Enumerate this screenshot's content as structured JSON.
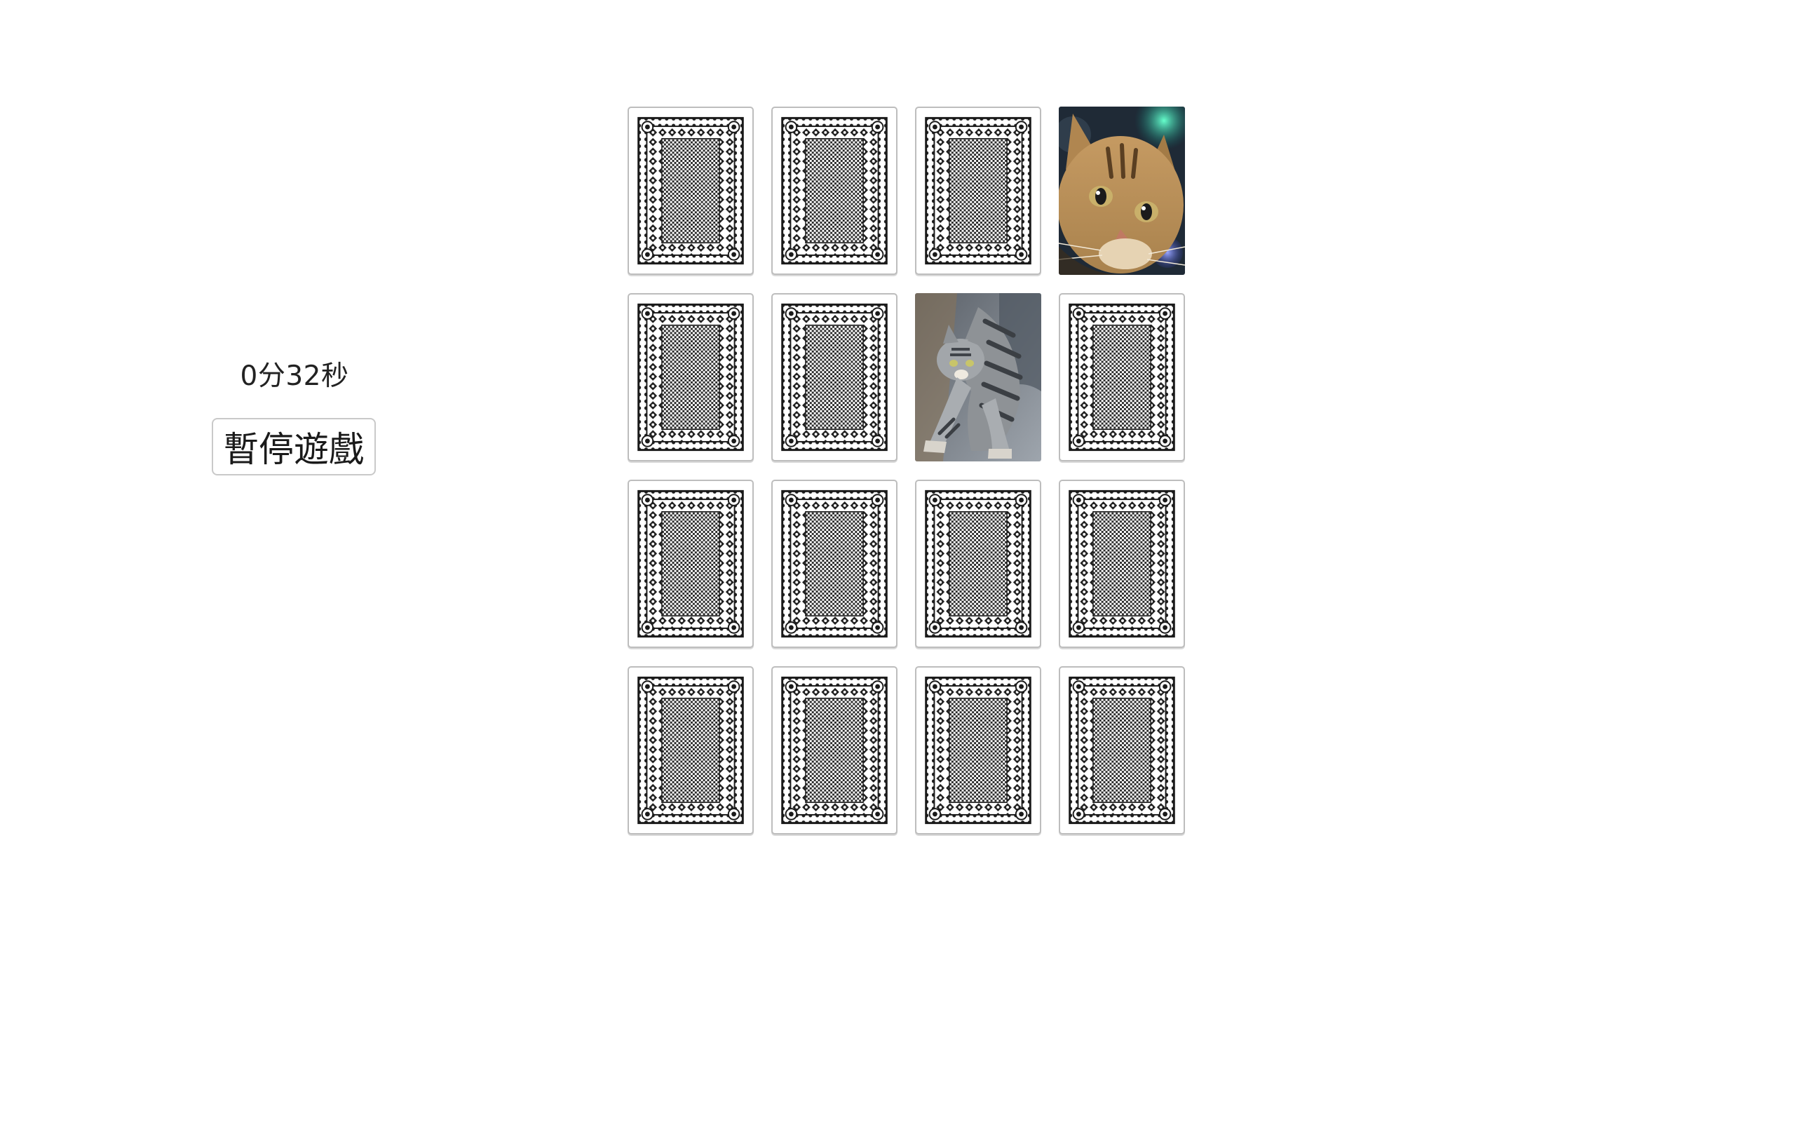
{
  "game": {
    "timer_text": "0分32秒",
    "pause_label": "暫停遊戲"
  },
  "board": {
    "rows": 4,
    "cols": 4,
    "cards": [
      {
        "state": "back"
      },
      {
        "state": "back"
      },
      {
        "state": "back"
      },
      {
        "state": "face",
        "image": "cat-portrait"
      },
      {
        "state": "back"
      },
      {
        "state": "back"
      },
      {
        "state": "face",
        "image": "cat-stretching"
      },
      {
        "state": "back"
      },
      {
        "state": "back"
      },
      {
        "state": "back"
      },
      {
        "state": "back"
      },
      {
        "state": "back"
      },
      {
        "state": "back"
      },
      {
        "state": "back"
      },
      {
        "state": "back"
      },
      {
        "state": "back"
      }
    ]
  },
  "colors": {
    "card_back_ink": "#1a1a1a",
    "card_border": "#bdbdbd"
  }
}
